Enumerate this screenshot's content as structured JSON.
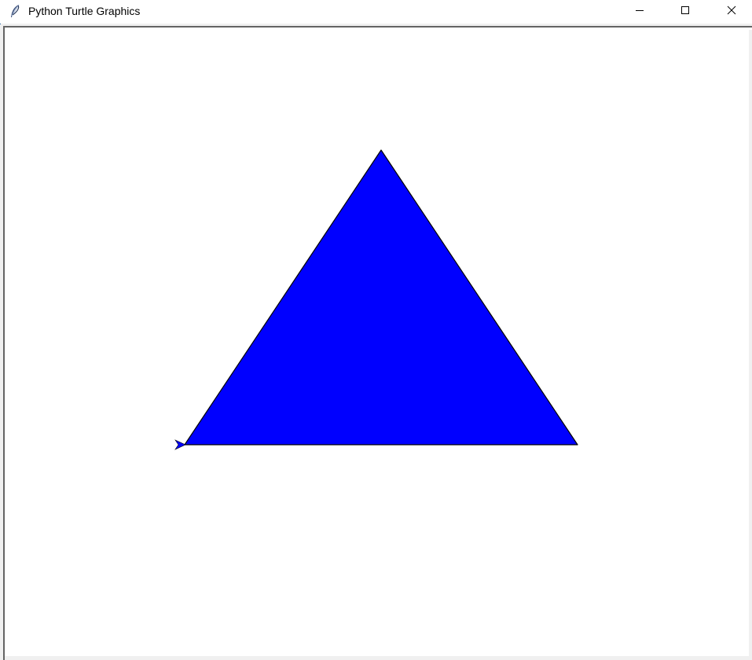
{
  "window": {
    "title": "Python Turtle Graphics",
    "app_icon": "feather-icon",
    "controls": {
      "minimize_icon": "minimize-icon",
      "maximize_icon": "maximize-icon",
      "close_icon": "close-icon"
    }
  },
  "canvas": {
    "background": "#ffffff",
    "shape": {
      "type": "triangle",
      "fill_color": "#0000ff",
      "outline_color": "#000000"
    },
    "turtle": {
      "icon": "turtle-arrow-icon",
      "color": "#0000ff",
      "heading": "east"
    }
  }
}
